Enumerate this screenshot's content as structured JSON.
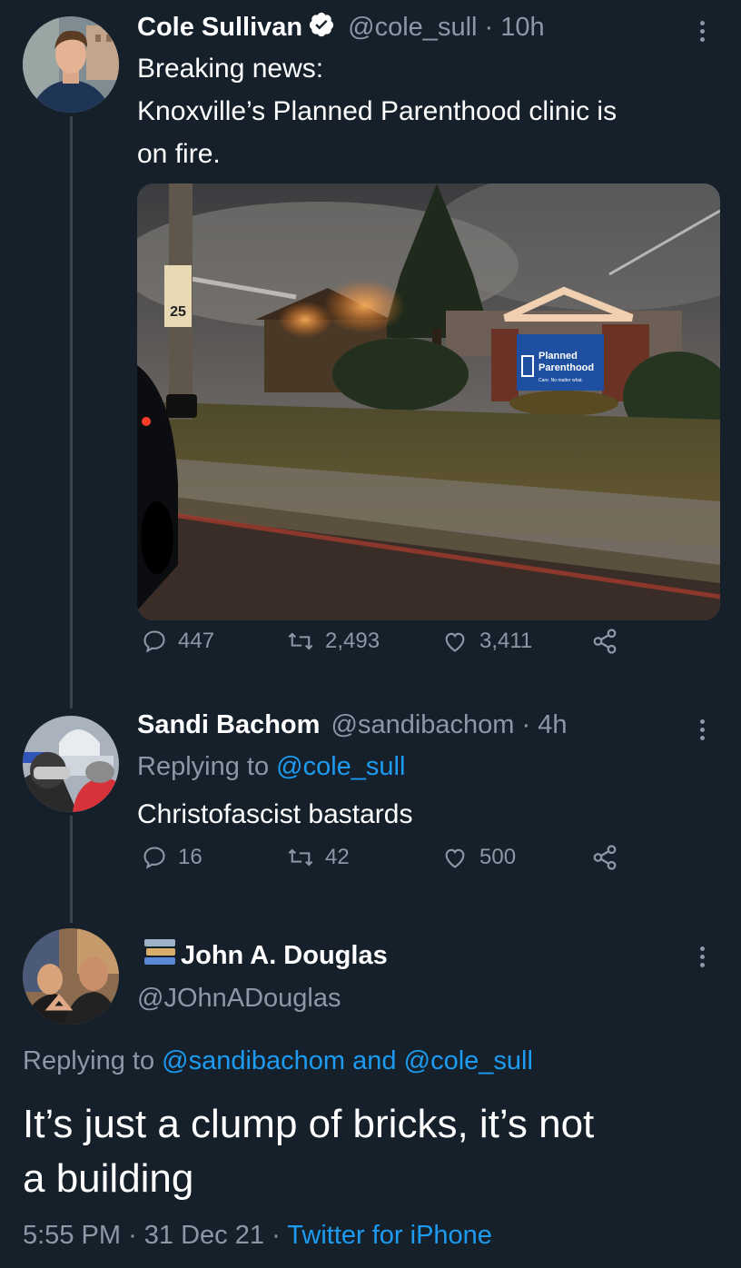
{
  "tweet1": {
    "name": "Cole Sullivan",
    "handle": "@cole_sull",
    "time": "10h",
    "text_line1": "Breaking news:",
    "text_line2": "Knoxville’s Planned Parenthood clinic is",
    "text_line3": "on fire.",
    "sign_line1": "Planned",
    "sign_line2": "Parenthood",
    "sign_tagline": "Care. No matter what.",
    "speed_sign": "25",
    "replies": "447",
    "retweets": "2,493",
    "likes": "3,411"
  },
  "tweet2": {
    "name": "Sandi Bachom",
    "handle": "@sandibachom",
    "time": "4h",
    "replying_prefix": "Replying to",
    "replying_to": "@cole_sull",
    "text": "Christofascist bastards",
    "replies": "16",
    "retweets": "42",
    "likes": "500"
  },
  "tweet3": {
    "name": "John A. Douglas",
    "handle": "@JOhnADouglas",
    "replying_prefix": "Replying to",
    "replying_to_1": "@sandibachom",
    "replying_and": "and",
    "replying_to_2": "@cole_sull",
    "text_line1": "It’s just a clump of bricks, it’s not",
    "text_line2": "a building",
    "time": "5:55 PM",
    "date": "31 Dec 21",
    "source": "Twitter for iPhone"
  },
  "separator": "·",
  "colors": {
    "background": "#15202b",
    "muted": "#8b98a5",
    "link": "#1d9bf0",
    "verified": "#ffffff"
  }
}
